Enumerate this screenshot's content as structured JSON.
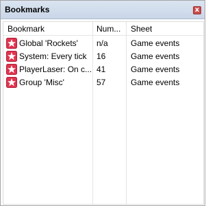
{
  "window": {
    "title": "Bookmarks",
    "close_glyph": "x"
  },
  "columns": [
    "Bookmark",
    "Num...",
    "Sheet"
  ],
  "rows": [
    {
      "bookmark": "Global 'Rockets'",
      "num": "n/a",
      "sheet": "Game events",
      "icon": "star-icon"
    },
    {
      "bookmark": "System: Every tick",
      "num": "16",
      "sheet": "Game events",
      "icon": "star-icon"
    },
    {
      "bookmark": "PlayerLaser: On c...",
      "num": "41",
      "sheet": "Game events",
      "icon": "star-icon"
    },
    {
      "bookmark": "Group 'Misc'",
      "num": "57",
      "sheet": "Game events",
      "icon": "star-icon"
    }
  ],
  "colors": {
    "icon_bg": "#e0344f",
    "titlebar": "#dbe5f1"
  }
}
